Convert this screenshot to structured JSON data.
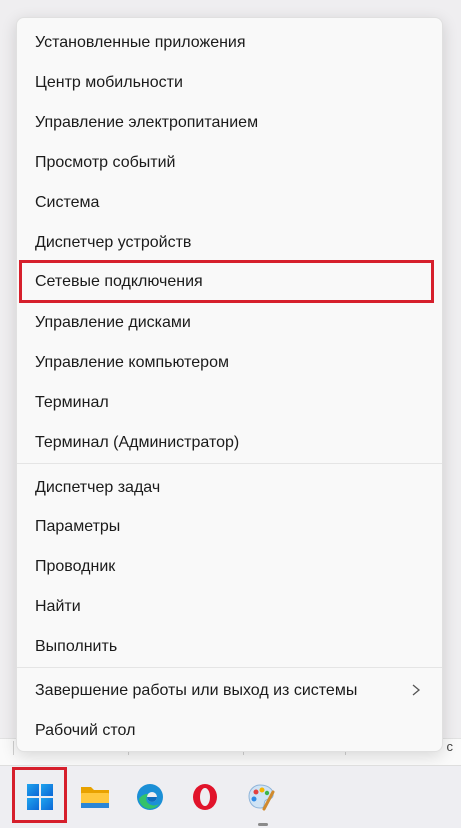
{
  "menu": {
    "items": [
      {
        "label": "Установленные приложения"
      },
      {
        "label": "Центр мобильности"
      },
      {
        "label": "Управление электропитанием"
      },
      {
        "label": "Просмотр событий"
      },
      {
        "label": "Система"
      },
      {
        "label": "Диспетчер устройств"
      },
      {
        "label": "Сетевые подключения"
      },
      {
        "label": "Управление дисками"
      },
      {
        "label": "Управление компьютером"
      },
      {
        "label": "Терминал"
      },
      {
        "label": "Терминал (Администратор)"
      },
      {
        "label": "Диспетчер задач"
      },
      {
        "label": "Параметры"
      },
      {
        "label": "Проводник"
      },
      {
        "label": "Найти"
      },
      {
        "label": "Выполнить"
      },
      {
        "label": "Завершение работы или выход из системы"
      },
      {
        "label": "Рабочий стол"
      }
    ],
    "highlighted_item": "Сетевые подключения"
  },
  "background": {
    "partial_text": "c"
  },
  "taskbar": {
    "icons": [
      "windows-start-icon",
      "file-explorer-icon",
      "edge-icon",
      "opera-icon",
      "paint-icon"
    ]
  },
  "colors": {
    "highlight": "#d61f2c",
    "menu_bg": "#f9f9f9",
    "taskbar_bg": "#eeeef2"
  }
}
